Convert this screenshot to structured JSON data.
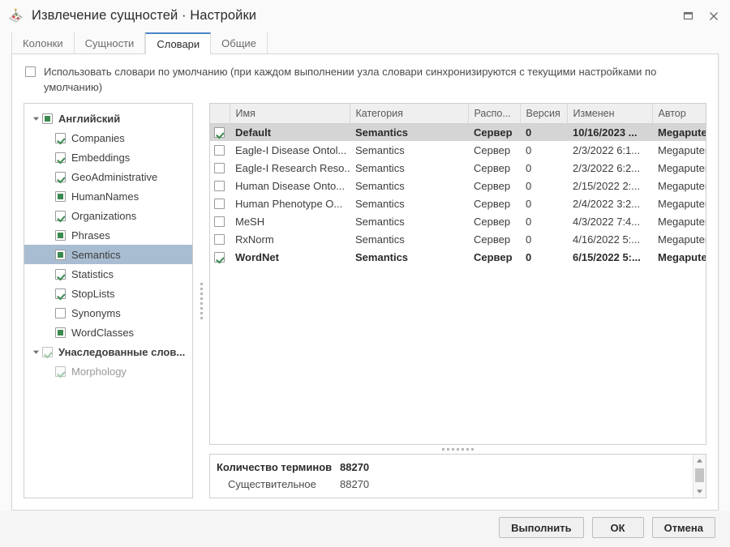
{
  "window": {
    "title": "Извлечение сущностей · Настройки",
    "app_icon": "entity-extraction-icon",
    "maximize_label": "Развернуть",
    "close_label": "Закрыть"
  },
  "tabs": [
    {
      "label": "Колонки",
      "active": false
    },
    {
      "label": "Сущности",
      "active": false
    },
    {
      "label": "Словари",
      "active": true
    },
    {
      "label": "Общие",
      "active": false
    }
  ],
  "defaults": {
    "checked": false,
    "label": "Использовать словари по умолчанию (при каждом выполнении узла словари синхронизируются с текущими настройками по умолчанию)"
  },
  "tree": {
    "items": [
      {
        "label": "Английский",
        "state": "partial",
        "level": 0,
        "bold": true,
        "expanded": true,
        "selected": false,
        "disabled": false
      },
      {
        "label": "Companies",
        "state": "checked",
        "level": 1,
        "bold": false,
        "expanded": null,
        "selected": false,
        "disabled": false
      },
      {
        "label": "Embeddings",
        "state": "checked",
        "level": 1,
        "bold": false,
        "expanded": null,
        "selected": false,
        "disabled": false
      },
      {
        "label": "GeoAdministrative",
        "state": "checked",
        "level": 1,
        "bold": false,
        "expanded": null,
        "selected": false,
        "disabled": false
      },
      {
        "label": "HumanNames",
        "state": "partial",
        "level": 1,
        "bold": false,
        "expanded": null,
        "selected": false,
        "disabled": false
      },
      {
        "label": "Organizations",
        "state": "checked",
        "level": 1,
        "bold": false,
        "expanded": null,
        "selected": false,
        "disabled": false
      },
      {
        "label": "Phrases",
        "state": "partial",
        "level": 1,
        "bold": false,
        "expanded": null,
        "selected": false,
        "disabled": false
      },
      {
        "label": "Semantics",
        "state": "partial",
        "level": 1,
        "bold": false,
        "expanded": null,
        "selected": true,
        "disabled": false
      },
      {
        "label": "Statistics",
        "state": "checked",
        "level": 1,
        "bold": false,
        "expanded": null,
        "selected": false,
        "disabled": false
      },
      {
        "label": "StopLists",
        "state": "checked",
        "level": 1,
        "bold": false,
        "expanded": null,
        "selected": false,
        "disabled": false
      },
      {
        "label": "Synonyms",
        "state": "unchecked",
        "level": 1,
        "bold": false,
        "expanded": null,
        "selected": false,
        "disabled": false
      },
      {
        "label": "WordClasses",
        "state": "partial",
        "level": 1,
        "bold": false,
        "expanded": null,
        "selected": false,
        "disabled": false
      },
      {
        "label": "Унаследованные слов...",
        "state": "checked",
        "level": 0,
        "bold": true,
        "expanded": true,
        "selected": false,
        "disabled": true
      },
      {
        "label": "Morphology",
        "state": "checked",
        "level": 1,
        "bold": false,
        "expanded": null,
        "selected": false,
        "disabled": true
      }
    ]
  },
  "table": {
    "columns": [
      {
        "key": "cb",
        "label": ""
      },
      {
        "key": "name",
        "label": "Имя"
      },
      {
        "key": "category",
        "label": "Категория"
      },
      {
        "key": "location",
        "label": "Распо..."
      },
      {
        "key": "version",
        "label": "Версия"
      },
      {
        "key": "modified",
        "label": "Изменен"
      },
      {
        "key": "author",
        "label": "Автор"
      }
    ],
    "rows": [
      {
        "checked": true,
        "name": "Default",
        "category": "Semantics",
        "location": "Сервер",
        "version": "0",
        "modified": "10/16/2023 ...",
        "author": "Megaputer",
        "selected": true,
        "bold": true
      },
      {
        "checked": false,
        "name": "Eagle-I Disease Ontol...",
        "category": "Semantics",
        "location": "Сервер",
        "version": "0",
        "modified": "2/3/2022 6:1...",
        "author": "Megaputer",
        "selected": false,
        "bold": false
      },
      {
        "checked": false,
        "name": "Eagle-I Research Reso...",
        "category": "Semantics",
        "location": "Сервер",
        "version": "0",
        "modified": "2/3/2022 6:2...",
        "author": "Megaputer",
        "selected": false,
        "bold": false
      },
      {
        "checked": false,
        "name": "Human Disease Onto...",
        "category": "Semantics",
        "location": "Сервер",
        "version": "0",
        "modified": "2/15/2022 2:...",
        "author": "Megaputer",
        "selected": false,
        "bold": false
      },
      {
        "checked": false,
        "name": "Human Phenotype O...",
        "category": "Semantics",
        "location": "Сервер",
        "version": "0",
        "modified": "2/4/2022 3:2...",
        "author": "Megaputer",
        "selected": false,
        "bold": false
      },
      {
        "checked": false,
        "name": "MeSH",
        "category": "Semantics",
        "location": "Сервер",
        "version": "0",
        "modified": "4/3/2022 7:4...",
        "author": "Megaputer",
        "selected": false,
        "bold": false
      },
      {
        "checked": false,
        "name": "RxNorm",
        "category": "Semantics",
        "location": "Сервер",
        "version": "0",
        "modified": "4/16/2022 5:...",
        "author": "Megaputer",
        "selected": false,
        "bold": false
      },
      {
        "checked": true,
        "name": "WordNet",
        "category": "Semantics",
        "location": "Сервер",
        "version": "0",
        "modified": "6/15/2022 5:...",
        "author": "Megaputer",
        "selected": false,
        "bold": true
      }
    ]
  },
  "details": {
    "rows": [
      {
        "key": "Количество терминов",
        "value": "88270",
        "head": true
      },
      {
        "key": "Существительное",
        "value": "88270",
        "head": false
      }
    ]
  },
  "footer": {
    "run_label": "Выполнить",
    "ok_label": "ОК",
    "cancel_label": "Отмена"
  },
  "colors": {
    "accent_tab": "#4a86c8",
    "checkbox_green": "#3a8a4f",
    "tree_selection": "#a9bdd2",
    "row_selection": "#d5d5d5"
  }
}
